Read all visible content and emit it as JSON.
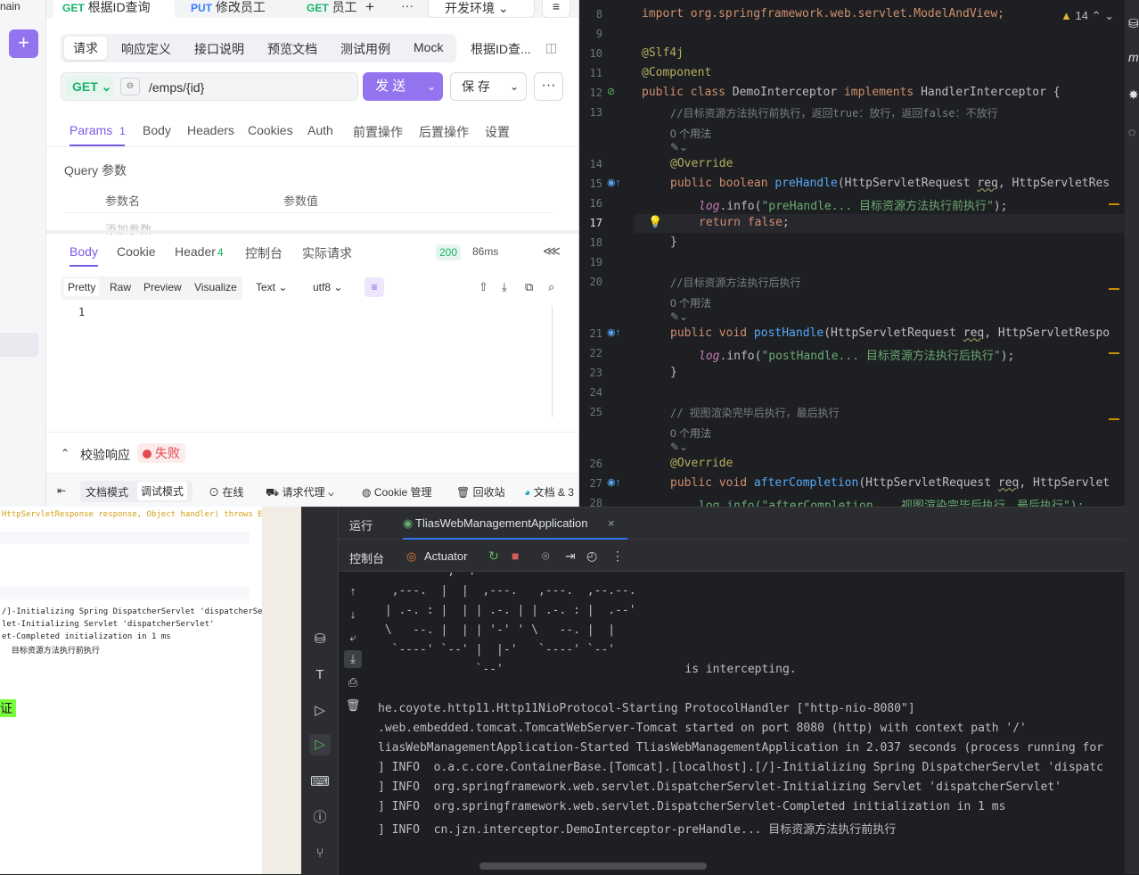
{
  "apifox": {
    "left": {
      "partial_label": "nain",
      "add_label": "+"
    },
    "tabs": [
      {
        "method": "GET",
        "label": "根据ID查询"
      },
      {
        "method": "PUT",
        "label": "修改员工"
      },
      {
        "method": "GET",
        "label": "员工"
      },
      {
        "label": "+"
      },
      {
        "label": "···"
      },
      {
        "label": "开发环境"
      },
      {
        "label": "≡"
      }
    ],
    "subtabs": [
      "请求",
      "响应定义",
      "接口说明",
      "预览文档",
      "测试用例",
      "Mock",
      "根据ID查..."
    ],
    "request": {
      "method": "GET",
      "url": "/emps/{id}",
      "send_label": "发 送",
      "save_label": "保 存",
      "more_label": "···"
    },
    "req_tabs": [
      "Params",
      "Body",
      "Headers",
      "Cookies",
      "Auth",
      "前置操作",
      "后置操作",
      "设置"
    ],
    "params_count": "1",
    "query": {
      "title": "Query 参数",
      "col_name": "参数名",
      "col_value": "参数值",
      "add_placeholder": "添加参数"
    },
    "res_tabs": [
      "Body",
      "Cookie",
      "Header",
      "控制台",
      "实际请求"
    ],
    "header_count": "4",
    "status": "200",
    "time": "86ms",
    "view_tabs": [
      "Pretty",
      "Raw",
      "Preview",
      "Visualize"
    ],
    "format": "Text",
    "encoding": "utf8",
    "body_line": "1",
    "validate": {
      "label": "校验响应",
      "result": "失败"
    },
    "footer": {
      "modes": [
        "文档模式",
        "调试模式"
      ],
      "items": [
        "在线",
        "请求代理",
        "Cookie 管理",
        "回收站",
        "文档 & 3"
      ]
    }
  },
  "editor": {
    "warnings": "14",
    "lines": [
      "8",
      "9",
      "10",
      "11",
      "12",
      "13",
      "14",
      "15",
      "16",
      "17",
      "18",
      "19",
      "20",
      "21",
      "22",
      "23",
      "24",
      "25",
      "26",
      "27",
      "28"
    ],
    "usage_hint": "0 个用法",
    "code": {
      "import": "import org.springframework.web.servlet.ModelAndView;",
      "slf4j": "@Slf4j",
      "component": "@Component",
      "class_kw": "public class ",
      "class_name": "DemoInterceptor ",
      "implements": "implements ",
      "iface": "HandlerInterceptor {",
      "c1": "//目标资源方法执行前执行，返回true：放行，返回false：不放行",
      "override": "@Override",
      "pre_sig_kw": "public boolean ",
      "pre_name": "preHandle",
      "pre_args_a": "(HttpServletRequest ",
      "req": "req",
      "pre_args_b": ", HttpServletRes",
      "log": "log",
      "info": ".info(",
      "pre_str": "\"preHandle... 目标资源方法执行前执行\"",
      "end": ");",
      "ret_kw": "return false",
      "semi": ";",
      "brace": "}",
      "c2": "//目标资源方法执行后执行",
      "post_sig_kw": "public void ",
      "post_name": "postHandle",
      "post_args_b": ", HttpServletRespo",
      "post_str": "\"postHandle... 目标资源方法执行后执行\"",
      "c3": "// 视图渲染完毕后执行，最后执行",
      "after_name": "afterCompletion",
      "after_args_b": ", HttpServlet",
      "after_partial": "log.info(\"afterCompletion... 视图渲染完毕后执行，最后执行\");"
    }
  },
  "run": {
    "tab_run": "运行",
    "tab_app": "TliasWebManagementApplication",
    "tab_close": "×",
    "console_label": "控制台",
    "actuator_label": "Actuator",
    "console_lines": [
      "          ,--.",
      "  ,---.  |  |  ,---.   ,---.  ,--.--.",
      " | .-. : |  | | .-. | | .-. : |  .--'",
      " \\   --. |  | | '-' ' \\   --. |  |",
      "  `----' `--' |  |-'   `----' `--'",
      "              `--'                          is intercepting.",
      "",
      "he.coyote.http11.Http11NioProtocol-Starting ProtocolHandler [\"http-nio-8080\"]",
      ".web.embedded.tomcat.TomcatWebServer-Tomcat started on port 8080 (http) with context path '/'",
      "liasWebManagementApplication-Started TliasWebManagementApplication in 2.037 seconds (process running for",
      "] INFO  o.a.c.core.ContainerBase.[Tomcat].[localhost].[/]-Initializing Spring DispatcherServlet 'dispatc",
      "] INFO  org.springframework.web.servlet.DispatcherServlet-Initializing Servlet 'dispatcherServlet'",
      "] INFO  org.springframework.web.servlet.DispatcherServlet-Completed initialization in 1 ms",
      "] INFO  cn.jzn.interceptor.DemoInterceptor-preHandle... 目标资源方法执行前执行"
    ]
  },
  "bg_browser": {
    "lines": [
      "HttpServletResponse response, Object handler) throws Exc",
      "/]-Initializing Spring DispatcherServlet 'dispatcherServ",
      "let-Initializing Servlet 'dispatcherServlet'",
      "et-Completed initialization in 1 ms",
      "  目标资源方法执行前执行"
    ],
    "badge": "证"
  },
  "colors": {
    "accent": "#9373ee",
    "ide_bg": "#1e1f22",
    "success": "#17b26a",
    "error": "#e5484d"
  }
}
